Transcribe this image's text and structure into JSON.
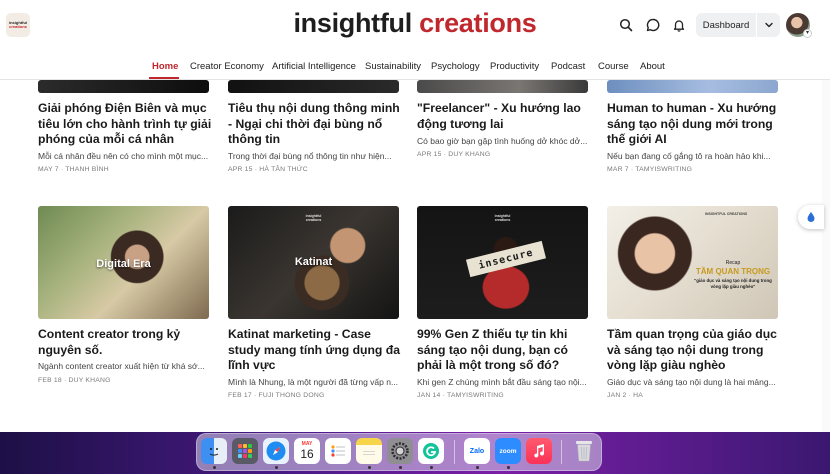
{
  "header": {
    "logo_line1": "insightful",
    "logo_line2": "creations",
    "brand_part1": "insightful",
    "brand_part2": "creations",
    "dashboard_label": "Dashboard"
  },
  "nav": {
    "items": [
      "Home",
      "Creator Economy",
      "Artificial Intelligence",
      "Sustainability",
      "Psychology",
      "Productivity",
      "Podcast",
      "Course",
      "About"
    ],
    "active": "Home"
  },
  "posts_row1": [
    {
      "title": "Giải phóng Điện Biên và mục tiêu lớn cho hành trình tự giải phóng của mỗi cá nhân",
      "excerpt": "Mỗi cá nhân đều nên có cho mình một mục...",
      "meta": "MAY 7 · THANH BÌNH"
    },
    {
      "title": "Tiêu thụ nội dung thông minh - Ngại chi thời đại bùng nổ thông tin",
      "excerpt": "Trong thời đại bùng nổ thông tin như hiện...",
      "meta": "APR 15 · HÀ TÂN THỨC"
    },
    {
      "title": "\"Freelancer\" - Xu hướng lao động tương lai",
      "excerpt": "Có bao giờ bạn gặp tình huống dở khóc dở...",
      "meta": "APR 15 · DUY KHANG"
    },
    {
      "title": "Human to human - Xu hướng sáng tạo nội dung mới trong thế giới AI",
      "excerpt": "Nếu bạn đang cố gắng tô ra hoàn hảo khi...",
      "meta": "MAR 7 · TAMYISWRITING"
    }
  ],
  "posts_row2": [
    {
      "title": "Content creator trong kỷ nguyên số.",
      "excerpt": "Ngành content creator xuất hiện từ khá sớ...",
      "meta": "FEB 18 · DUY KHANG",
      "image_label": "Digital Era"
    },
    {
      "title": "Katinat marketing - Case study mang tính ứng dụng đa lĩnh vực",
      "excerpt": "Mình là Nhung, là một người đã từng vấp n...",
      "meta": "FEB 17 · FUJI THONG DONG",
      "image_label": "Katinat"
    },
    {
      "title": "99% Gen Z thiếu tự tin khi sáng tạo nội dung, bạn có phải là một trong số đó?",
      "excerpt": "Khi gen Z chúng mình bắt đầu sáng tạo nội...",
      "meta": "JAN 14 · TAMYISWRITING",
      "image_label": "insecure"
    },
    {
      "title": "Tầm quan trọng của giáo dục và sáng tạo nội dung trong vòng lặp giàu nghèo",
      "excerpt": "Giáo dục và sáng tạo nội dung là hai mảng...",
      "meta": "JAN 2 · HA",
      "image_label_small": "Recap",
      "image_label": "TẦM QUAN TRỌNG",
      "image_sub": "\"giáo dục và sáng tạo nội dung trong vòng lặp giàu nghèo\""
    }
  ],
  "dock": {
    "calendar_month": "MAY",
    "calendar_day": "16",
    "zalo": "Zalo",
    "zoom": "zoom"
  },
  "colors": {
    "accent": "#c0282e",
    "text": "#1a1a1a"
  }
}
